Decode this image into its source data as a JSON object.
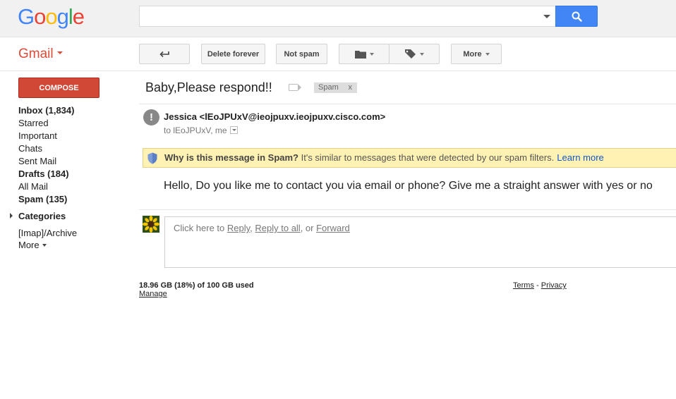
{
  "logo": {
    "text": "Google",
    "letters": [
      "G",
      "o",
      "o",
      "g",
      "l",
      "e"
    ],
    "colors": [
      "#4285f4",
      "#ea4335",
      "#fbbc05",
      "#4285f4",
      "#34a853",
      "#ea4335"
    ]
  },
  "search": {
    "value": "",
    "button_icon": "search-icon"
  },
  "app": {
    "name": "Gmail",
    "accent_color": "#dd4b39"
  },
  "toolbar": {
    "back_icon": "back-arrow-icon",
    "delete_forever_label": "Delete forever",
    "not_spam_label": "Not spam",
    "move_icon": "folder-icon",
    "labels_icon": "tag-icon",
    "more_label": "More"
  },
  "sidebar": {
    "compose_label": "COMPOSE",
    "items": [
      {
        "label": "Inbox (1,834)",
        "bold": true
      },
      {
        "label": "Starred",
        "bold": false
      },
      {
        "label": "Important",
        "bold": false
      },
      {
        "label": "Chats",
        "bold": false
      },
      {
        "label": "Sent Mail",
        "bold": false
      },
      {
        "label": "Drafts (184)",
        "bold": true
      },
      {
        "label": "All Mail",
        "bold": false
      },
      {
        "label": "Spam (135)",
        "bold": true
      }
    ],
    "categories_label": "Categories",
    "archive_label": "[Imap]/Archive",
    "more_label": "More"
  },
  "message": {
    "subject": "Baby,Please respond!!",
    "label_chip": "Spam",
    "label_chip_remove": "x",
    "sender": "Jessica <lEoJPUxV@ieojpuxv.ieojpuxv.cisco.com>",
    "to_line": "to lEoJPUxV, me",
    "spam_banner": {
      "bold": "Why is this message in Spam?",
      "text": " It's similar to messages that were detected by our spam filters.",
      "learn_more": "Learn more"
    },
    "body": "Hello, Do you like me to contact you via email or phone? Give me a straight answer with yes or no"
  },
  "reply": {
    "prefix": "Click here to ",
    "reply_label": "Reply",
    "sep1": ", ",
    "reply_all_label": "Reply to all",
    "sep2": ", or ",
    "forward_label": "Forward"
  },
  "footer": {
    "storage": "18.96 GB (18%) of 100 GB used",
    "manage": "Manage",
    "terms": "Terms",
    "dash": " - ",
    "privacy": "Privacy"
  }
}
